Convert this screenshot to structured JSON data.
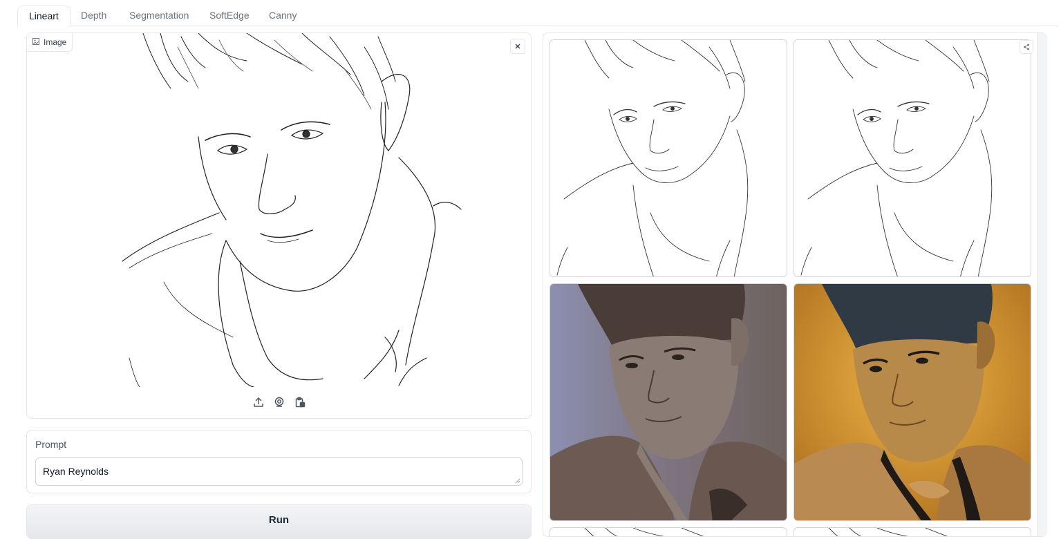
{
  "tabs": [
    {
      "label": "Lineart",
      "active": true
    },
    {
      "label": "Depth",
      "active": false
    },
    {
      "label": "Segmentation",
      "active": false
    },
    {
      "label": "SoftEdge",
      "active": false
    },
    {
      "label": "Canny",
      "active": false
    }
  ],
  "image_panel": {
    "label": "Image",
    "label_icon": "image-icon",
    "close_icon": "close-icon",
    "toolbar_icons": [
      "upload-icon",
      "webcam-icon",
      "clipboard-icon"
    ]
  },
  "prompt": {
    "label": "Prompt",
    "value": "Ryan Reynolds"
  },
  "run_button": {
    "label": "Run"
  },
  "gallery": {
    "share_icon": "share-icon",
    "items": [
      {
        "kind": "lineart",
        "tone": "#ffffff"
      },
      {
        "kind": "lineart",
        "tone": "#ffffff"
      },
      {
        "kind": "portrait-muted",
        "tone": "#7a6d6a"
      },
      {
        "kind": "portrait-golden",
        "tone": "#c9902e"
      }
    ]
  },
  "colors": {
    "accent_tab_border": "#e5e7eb",
    "muted_bg": "#8a8ea8",
    "golden_bg": "#d89a2b"
  }
}
